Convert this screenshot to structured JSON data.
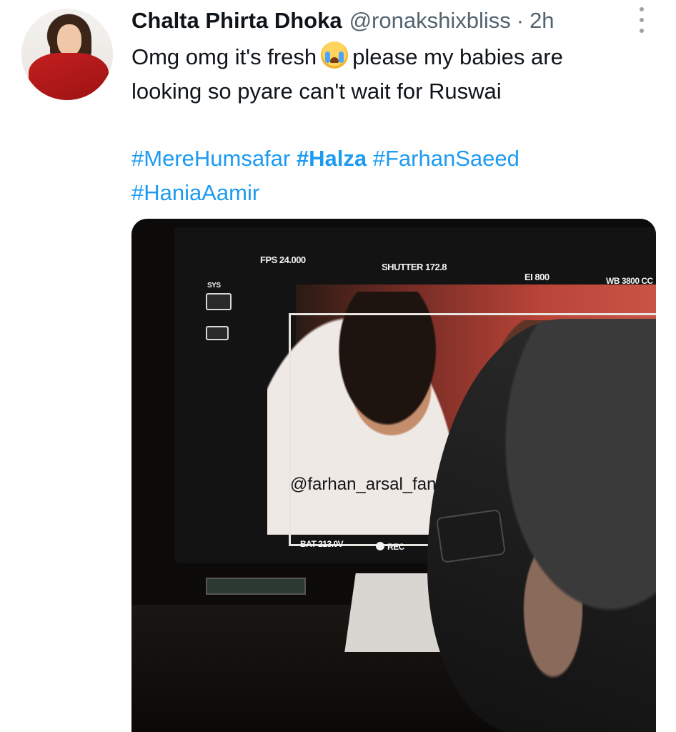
{
  "tweet": {
    "author_name": "Chalta Phirta Dhoka",
    "handle": "@ronakshixbliss",
    "separator": "·",
    "time": "2h",
    "text_line1_a": "Omg omg it's fresh",
    "text_line1_b": "please my babies are",
    "text_line2": "looking so pyare can't wait for Ruswai",
    "emoji_icon": "loudly-crying-face-icon",
    "hashtags": [
      "#MereHumsafar",
      "#Halza",
      "#FarhanSaeed",
      "#HaniaAamir"
    ]
  },
  "media": {
    "osd_fps": "FPS 24.000",
    "osd_shutter": "SHUTTER 172.8",
    "osd_ei": "EI 800",
    "osd_wb": "WB 3800 CC",
    "osd_sys": "SYS",
    "osd_bat": "BAT 213.0V",
    "osd_rec": "REC",
    "watermark": "@farhan_arsal_fanpage"
  },
  "colors": {
    "link": "#1d9bf0",
    "secondary_text": "#536471",
    "primary_text": "#0f1419"
  }
}
